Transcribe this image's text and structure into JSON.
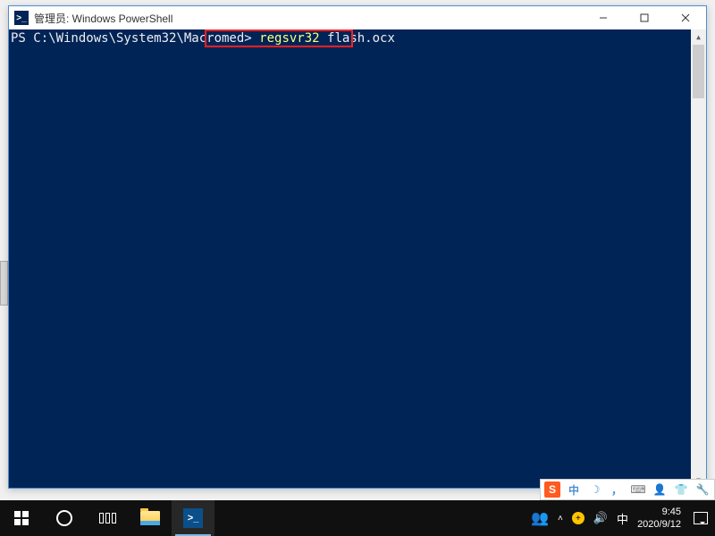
{
  "window": {
    "title": "管理员: Windows PowerShell"
  },
  "terminal": {
    "prompt": "PS C:\\Windows\\System32\\Macromed>",
    "command_cmd": "regsvr32",
    "command_arg": "flash.ocx"
  },
  "ime": {
    "s": "S",
    "zh": "中",
    "moon": "☽",
    "comma": "，",
    "kbd": "⌨",
    "user": "👤",
    "shirt": "👕",
    "wrench": "🔧"
  },
  "taskbar": {
    "ps_label": ">_",
    "people": "👥",
    "chevron": "˄",
    "plus": "+",
    "volume": "🔊",
    "ime_ch": "中",
    "time": "9:45",
    "date": "2020/9/12"
  }
}
